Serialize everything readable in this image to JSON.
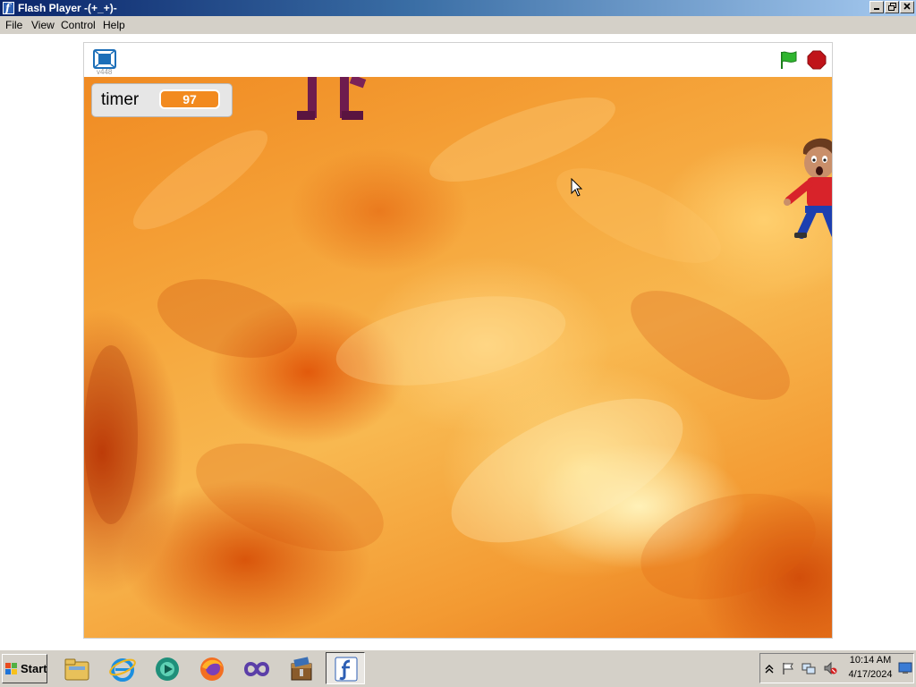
{
  "window": {
    "title": "Flash Player  -(+_+)-"
  },
  "menu": {
    "items": [
      {
        "label": "File"
      },
      {
        "label": "View"
      },
      {
        "label": "Control"
      },
      {
        "label": "Help"
      }
    ]
  },
  "player": {
    "version_label": "v448",
    "toolbar_icons": [
      "fullscreen-icon",
      "green-flag-icon",
      "stop-icon"
    ],
    "colors": {
      "flag": "#2fb52f",
      "stop": "#c0141a",
      "timer_value_bg": "#f28a1f"
    }
  },
  "stage": {
    "monitor": {
      "label": "timer",
      "value": "97"
    },
    "background": "fire",
    "sprites": [
      "purple-legs-sprite",
      "boy-character-sprite"
    ]
  },
  "taskbar": {
    "start_label": "Start",
    "pinned": [
      {
        "name": "file-explorer-icon"
      },
      {
        "name": "internet-explorer-icon"
      },
      {
        "name": "media-app-icon"
      },
      {
        "name": "firefox-icon"
      },
      {
        "name": "visual-studio-icon"
      },
      {
        "name": "archive-app-icon"
      },
      {
        "name": "flash-player-icon",
        "active": true
      }
    ],
    "tray_icons": [
      "show-hidden-icons-chevron",
      "action-center-flag-icon",
      "network-icon",
      "volume-muted-icon"
    ],
    "clock": {
      "time": "10:14 AM",
      "date": "4/17/2024"
    }
  }
}
